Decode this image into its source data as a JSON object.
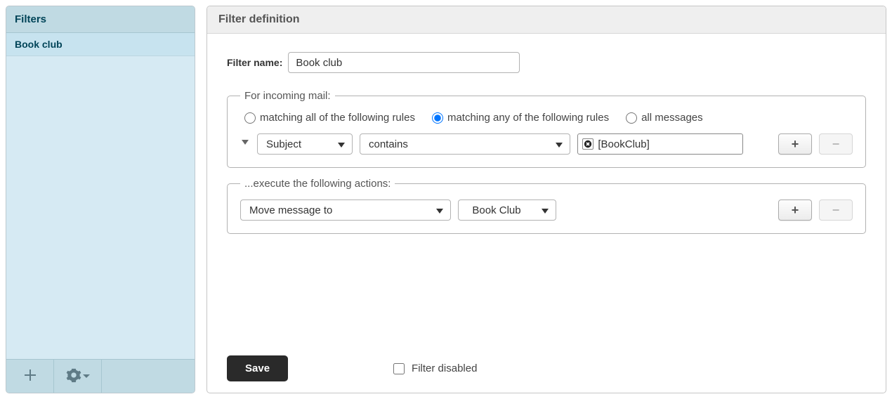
{
  "sidebar": {
    "title": "Filters",
    "items": [
      {
        "label": "Book club"
      }
    ]
  },
  "header": {
    "title": "Filter definition"
  },
  "form": {
    "name_label": "Filter name:",
    "name_value": "Book club",
    "rules_legend": "For incoming mail:",
    "match_all_label": "matching all of the following rules",
    "match_any_label": "matching any of the following rules",
    "all_messages_label": "all messages",
    "rule": {
      "field": "Subject",
      "operator": "contains",
      "value": "[BookClub]"
    },
    "actions_legend": "...execute the following actions:",
    "action": {
      "type": "Move message to",
      "target": "Book Club"
    }
  },
  "footer": {
    "save_label": "Save",
    "disabled_label": "Filter disabled"
  },
  "glyphs": {
    "plus": "+",
    "minus": "−"
  }
}
